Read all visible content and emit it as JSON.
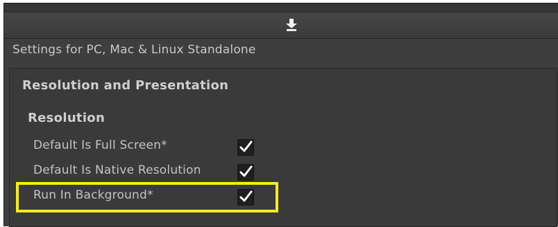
{
  "toolbar": {
    "icon": "download-icon"
  },
  "platform": {
    "title": "Settings for PC, Mac & Linux Standalone"
  },
  "section": {
    "title": "Resolution and Presentation",
    "subsection_title": "Resolution",
    "items": [
      {
        "label": "Default Is Full Screen*",
        "checked": true
      },
      {
        "label": "Default Is Native Resolution",
        "checked": true
      },
      {
        "label": "Run In Background*",
        "checked": true
      }
    ]
  },
  "annotation": {
    "highlight_color": "#f7ee19",
    "highlighted_item": "Run In Background*"
  },
  "colors": {
    "panel_bg": "#3a3a3a",
    "text": "#c4c4c4",
    "checkbox_bg": "#1f1f1f",
    "checkmark": "#ffffff"
  }
}
